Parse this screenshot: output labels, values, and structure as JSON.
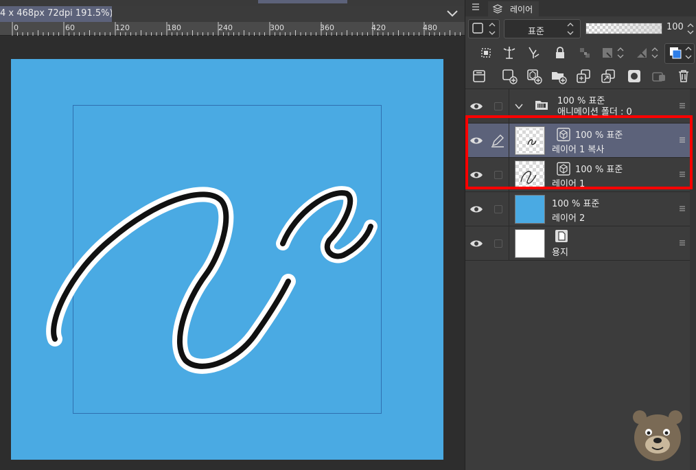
{
  "canvas": {
    "doc_title": "4 x 468px 72dpi 191.5%)",
    "ruler_ticks": [
      "0",
      "60",
      "120",
      "180",
      "240",
      "300",
      "360",
      "420",
      "480"
    ],
    "paper_color": "#4aaae3"
  },
  "panel": {
    "tab_label": "레이어",
    "blend_mode": "표준",
    "opacity": "100",
    "layers": [
      {
        "opacity_blend": "100 % 표준",
        "name": "애니메이션 폴더 : 0",
        "type": "folder",
        "selected": false
      },
      {
        "opacity_blend": "100 % 표준",
        "name": "레이어 1 복사",
        "type": "vector",
        "selected": true
      },
      {
        "opacity_blend": "100 % 표준",
        "name": "레이어 1",
        "type": "vector",
        "selected": false
      },
      {
        "opacity_blend": "100 % 표준",
        "name": "레이어 2",
        "type": "raster",
        "selected": false
      },
      {
        "opacity_blend": "",
        "name": "용지",
        "type": "paper",
        "selected": false
      }
    ]
  },
  "colors": {
    "accent_selected_row": "#5c627a",
    "highlight_box": "#ff0000",
    "panel_bg": "#3c3c3c"
  },
  "icons": {
    "toolbar_row_1": [
      "ref-layer-icon",
      "lighthouse-icon",
      "pen-lock-icon",
      "lock-icon",
      "transparency-lock-icon",
      "clip-icon",
      "mask-icon",
      "color-icon"
    ],
    "toolbar_row_2": [
      "layer-props-icon",
      "new-raster-icon",
      "new-vector-icon",
      "new-folder-icon",
      "copy-down-icon",
      "merge-icon",
      "mask-add-icon",
      "adjust-icon",
      "trash-icon"
    ]
  }
}
